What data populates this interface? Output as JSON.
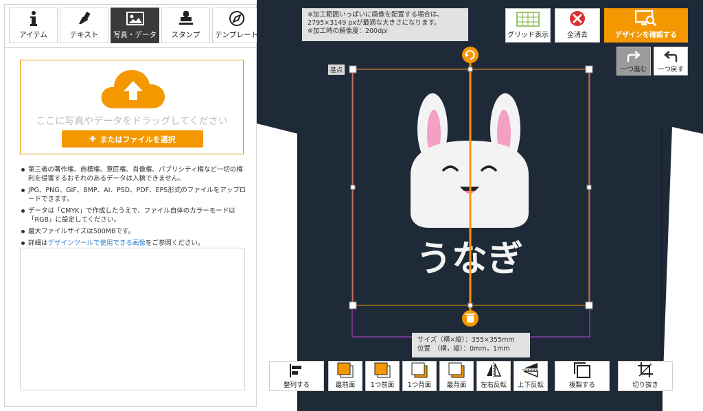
{
  "tabs": [
    {
      "label": "アイテム",
      "icon": "info-icon"
    },
    {
      "label": "テキスト",
      "icon": "pen-icon"
    },
    {
      "label": "写真・データ",
      "icon": "image-icon"
    },
    {
      "label": "スタンプ",
      "icon": "stamp-icon"
    },
    {
      "label": "テンプレート",
      "icon": "compass-icon"
    }
  ],
  "upload": {
    "drop_text": "ここに写真やデータをドラッグしてください",
    "button_label": "またはファイルを選択"
  },
  "notes": {
    "n1": "第三者の著作権、商標権、意匠権、肖像権、パブリシティ権など一切の権利を侵害するおそれのあるデータは入稿できません。",
    "n2": "JPG、PNG、GIF、BMP、AI、PSD、PDF、EPS形式のファイルをアップロードできます。",
    "n3": "データは「CMYK」で作成したうえで、ファイル自体のカラーモードは「RGB」に設定してください。",
    "n4": "最大ファイルサイズは500MBです。",
    "n5_prefix": "詳細は",
    "n5_link": "デザインツールで使用できる画像",
    "n5_suffix": "をご参照ください。"
  },
  "info": {
    "line1": "※加工範囲いっぱいに画像を配置する場合は、",
    "line2": "2795×3149 pxが最適な大きさになります。",
    "line3": "※加工時の解像度：200dpi"
  },
  "toolbar": {
    "grid_label": "グリッド表示",
    "clear_label": "全消去",
    "confirm_label": "デザインを確認する",
    "redo_label": "一つ進む",
    "undo_label": "一つ戻す"
  },
  "design": {
    "base_point": "基点",
    "text": "うなぎ"
  },
  "size_info": {
    "size_line": "サイズ（横×縦）：355×355mm",
    "pos_line": "位置　（横，縦）：0mm，1mm"
  },
  "bottom_tools": [
    "整列する",
    "最前面",
    "1つ前面",
    "1つ背面",
    "最背面",
    "左右反転",
    "上下反転",
    "複製する",
    "切り抜き"
  ],
  "colors": {
    "accent": "#f39800",
    "shirt": "#1f2a38",
    "selection": "#a23fc0"
  }
}
